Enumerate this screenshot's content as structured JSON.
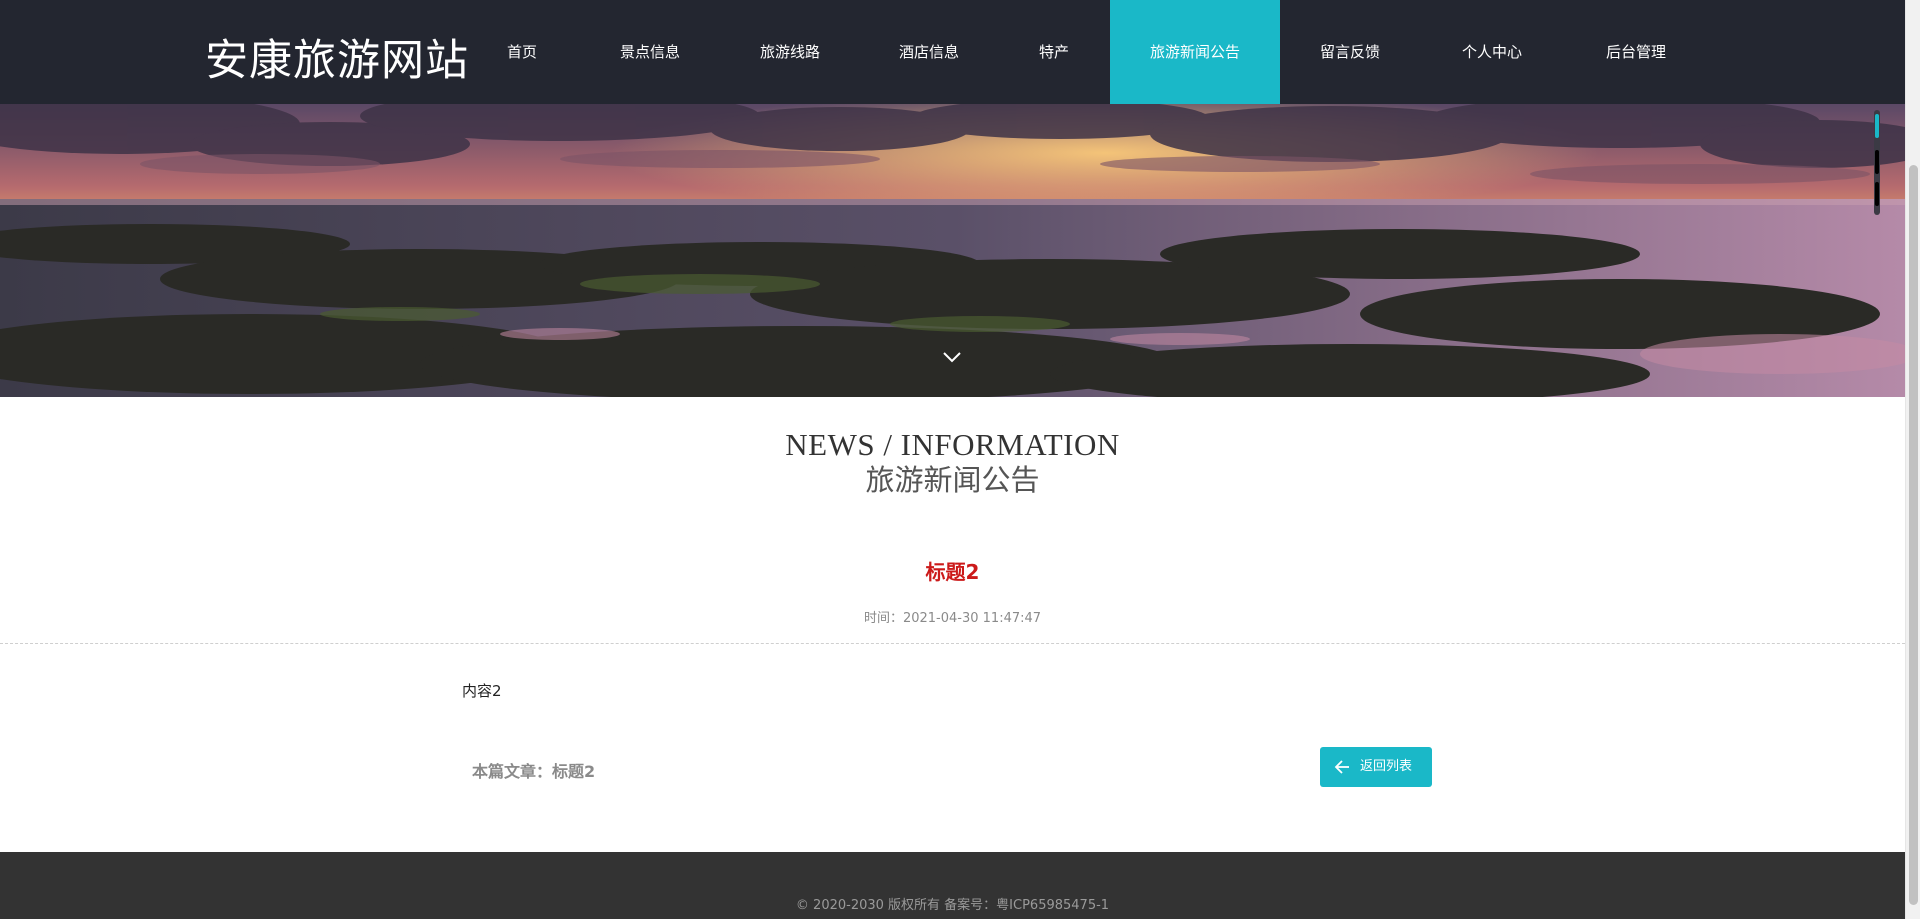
{
  "site": {
    "logo_text": "安康旅游网站"
  },
  "nav": {
    "items": [
      {
        "label": "首页"
      },
      {
        "label": "景点信息"
      },
      {
        "label": "旅游线路"
      },
      {
        "label": "酒店信息"
      },
      {
        "label": "特产"
      },
      {
        "label": "旅游新闻公告",
        "active": true
      },
      {
        "label": "留言反馈"
      },
      {
        "label": "个人中心"
      },
      {
        "label": "后台管理"
      }
    ]
  },
  "section": {
    "title_en": "NEWS / INFORMATION",
    "title_cn": "旅游新闻公告"
  },
  "article": {
    "title": "标题2",
    "time_label": "时间：",
    "time_value": "2021-04-30 11:47:47",
    "content": "内容2",
    "current_label": "本篇文章：",
    "current_title": "标题2",
    "back_label": "返回列表"
  },
  "footer": {
    "copyright": "© 2020-2030 版权所有 备案号：粤ICP65985475-1"
  },
  "colors": {
    "header_bg": "#232630",
    "accent": "#1ab8c8",
    "article_title": "#cc1a1a",
    "footer_bg": "#333333"
  }
}
